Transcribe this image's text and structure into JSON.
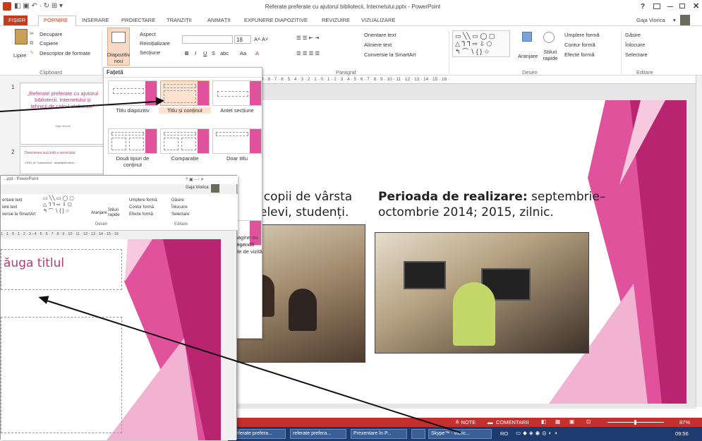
{
  "titlebar": {
    "title": "Referate preferate cu ajutorul bibliotecii, Internetului.pptx - PowerPoint",
    "help": "?",
    "user": "Gaja Viorica",
    "user_arrow": "▾",
    "qat": "◧ ▣ ↶ · ↻ ⊞ ▾"
  },
  "tabs": [
    "FIȘIER",
    "PORNIRE",
    "INSERARE",
    "PROIECTARE",
    "TRANZIȚII",
    "ANIMAȚII",
    "EXPUNERE DIAPOZITIVE",
    "REVIZUIRE",
    "VIZUALIZARE"
  ],
  "ribbon": {
    "clipboard": {
      "paste": "Lipire",
      "cut": "Decupare",
      "copy": "Copiere",
      "format": "Descriptor de formate",
      "label": "Clipboard"
    },
    "slides": {
      "new": "Diapozitiv nou",
      "layout": "Aspect",
      "reset": "Reinițializare",
      "section": "Secțiune"
    },
    "font": {
      "size": "18"
    },
    "paragraph": {
      "direction": "Orientare text",
      "align": "Aliniere text",
      "smartart": "Conversie la SmartArt",
      "label": "Paragraf"
    },
    "drawing": {
      "arrange": "Aranjare",
      "styles": "Stiluri rapide",
      "fill": "Umplere formă",
      "outline": "Contur formă",
      "effects": "Efecte formă",
      "label": "Desen"
    },
    "editing": {
      "find": "Găsire",
      "replace": "Înlocuire",
      "select": "Selectare",
      "label": "Editare"
    }
  },
  "ruler": "· 9 · 8 · 7 · 6 · 5 · 4 · 3 · 2 · 1 · 0 · 1 · 2 · 3 · 4 · 5 · 6 · 7 · 8 · 9 · 10 · 11 · 12 · 13 · 14 · 15 · 16 ·",
  "thumbs": [
    {
      "num": "1",
      "title": "„Referate preferate cu ajutorul bibliotecii, Internetului și tehnicii de calcul elaborate”",
      "sub": "Gaja Viorica"
    },
    {
      "num": "2",
      "title": "Descrierea succintă a serviciului:",
      "sub": "CRDI „M. Sadoveanu”, amabilitati elevii ..."
    }
  ],
  "dropdown": {
    "header": "Fațetă",
    "layouts": [
      "Titlu diapozitiv",
      "Titlu și conținut",
      "Antet secțiune",
      "Două tipuri de conținut",
      "Comparație",
      "Doar titlu",
      "Imagine cu legendă",
      "Carte de vizită"
    ]
  },
  "slide": {
    "left_text": ":copii de vârsta\nelevi, studenți.",
    "right_label": "Perioada de realizare:",
    "right_text": " septembrie–\noctombrie 2014; 2015, zilnic."
  },
  "overlay": {
    "title": "...ppt - PowerPoint",
    "user": "Gaja Viorica",
    "text_dir": "entare text",
    "align": "iere text",
    "smartart": "versie la SmartArt",
    "arrange": "Aranjare",
    "styles": "Stiluri rapide",
    "fill": "Umplere formă",
    "outline": "Contur formă",
    "effects": "Efecte formă",
    "find": "Găsire",
    "replace": "Înlocuire",
    "select": "Selectare",
    "g_desen": "Desen",
    "g_edit": "Editare",
    "ruler": "1 · 1 · 0 · 1 · 2 · 3 · 4 · 5 · 6 · 7 · 8 · 9 · 10 · 11 · 12 · 13 · 14 · 15 · 16",
    "placeholder": "ăuga titlul"
  },
  "statusbar": {
    "notes": "≙ NOTE",
    "comments": "COMENTARII",
    "zoom": "87%"
  },
  "taskbar": {
    "items": [
      "Referate prefera...",
      "referate prefera...",
      "Prezentare în P...",
      "",
      "Skype™ - vioric..."
    ],
    "lang": "RO",
    "time": "09:56"
  },
  "colors": {
    "accent": "#c43b1d",
    "magenta": "#e0529c",
    "status": "#c3302d",
    "taskbar": "#1d3b6e"
  }
}
